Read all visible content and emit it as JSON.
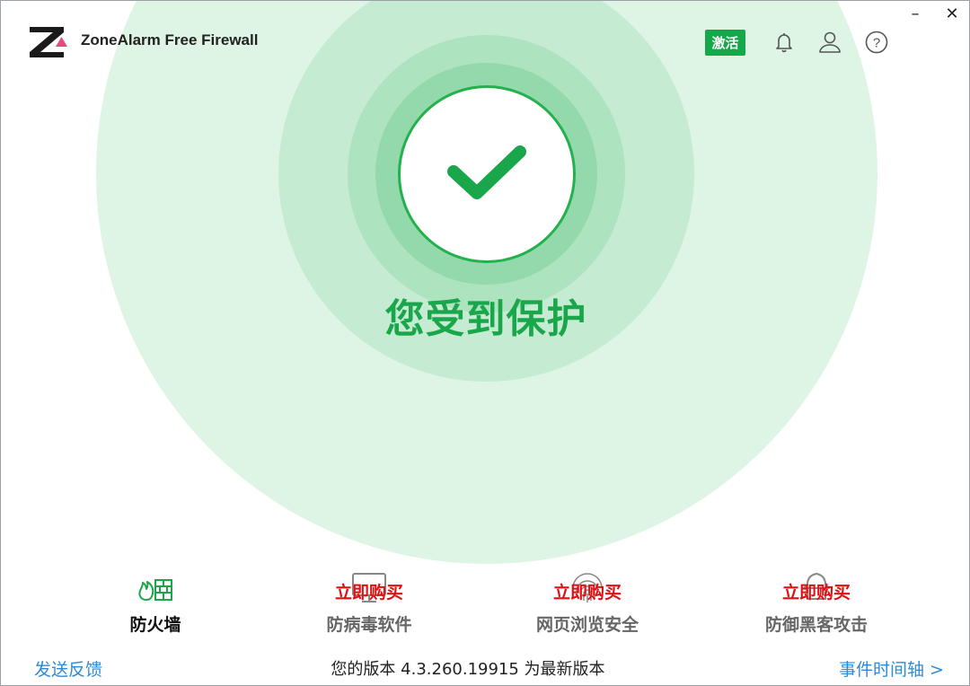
{
  "header": {
    "app_title": "ZoneAlarm Free Firewall",
    "activate_label": "激活",
    "icons": [
      "bell-icon",
      "user-icon",
      "help-icon"
    ],
    "window_controls": {
      "minimize": "–",
      "close": "✕"
    }
  },
  "status": {
    "text": "您受到保护",
    "icon": "checkmark-icon"
  },
  "features": [
    {
      "label": "防火墙",
      "badge": "",
      "icon": "firewall-icon",
      "state": "active"
    },
    {
      "label": "防病毒软件",
      "badge": "立即购买",
      "icon": "monitor-icon",
      "state": "inactive"
    },
    {
      "label": "网页浏览安全",
      "badge": "立即购买",
      "icon": "fingerprint-icon",
      "state": "inactive"
    },
    {
      "label": "防御黑客攻击",
      "badge": "立即购买",
      "icon": "hacker-icon",
      "state": "inactive"
    }
  ],
  "footer": {
    "feedback": "发送反馈",
    "version": "您的版本 4.3.260.19915 为最新版本",
    "timeline": "事件时间轴 >"
  },
  "colors": {
    "accent_green": "#1aa64a",
    "buy_red": "#e01010",
    "link_blue": "#2e8ad6"
  }
}
